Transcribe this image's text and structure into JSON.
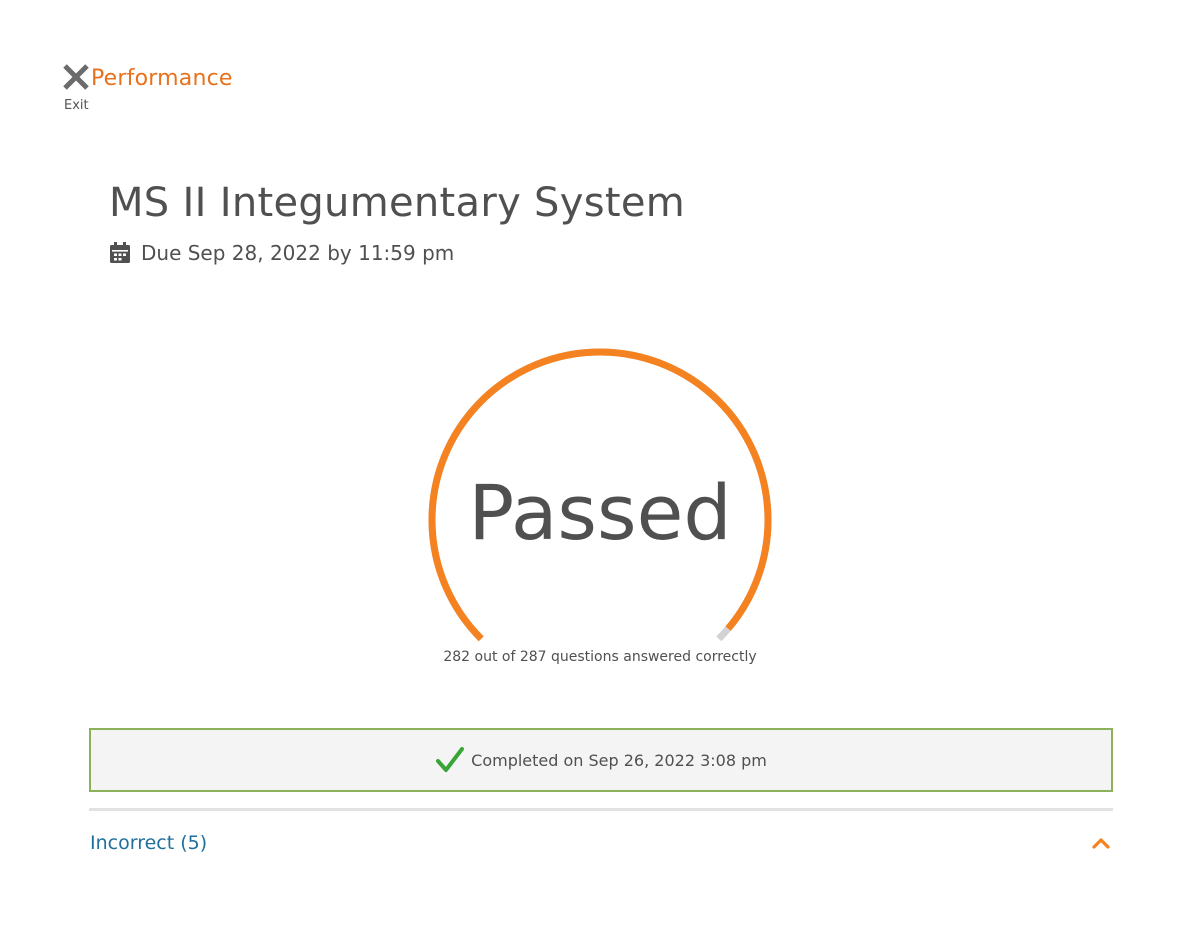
{
  "header": {
    "title": "Performance",
    "exit_label": "Exit"
  },
  "assignment": {
    "title": "MS II Integumentary System",
    "due": "Due Sep 28, 2022 by 11:59 pm"
  },
  "result": {
    "status": "Passed",
    "correct": 282,
    "total": 287,
    "summary": "282 out of 287 questions answered correctly"
  },
  "completion": {
    "text": "Completed on Sep 26, 2022 3:08 pm"
  },
  "incorrect_section": {
    "label": "Incorrect (5)"
  },
  "colors": {
    "accent": "#f58220",
    "track": "#d3d3d3",
    "success": "#3aa537",
    "banner_border": "#8db05a",
    "link": "#1e6f9c"
  },
  "icons": {
    "exit": "close-icon",
    "due": "calendar-icon",
    "completed": "check-icon",
    "section_toggle": "chevron-up-icon"
  }
}
